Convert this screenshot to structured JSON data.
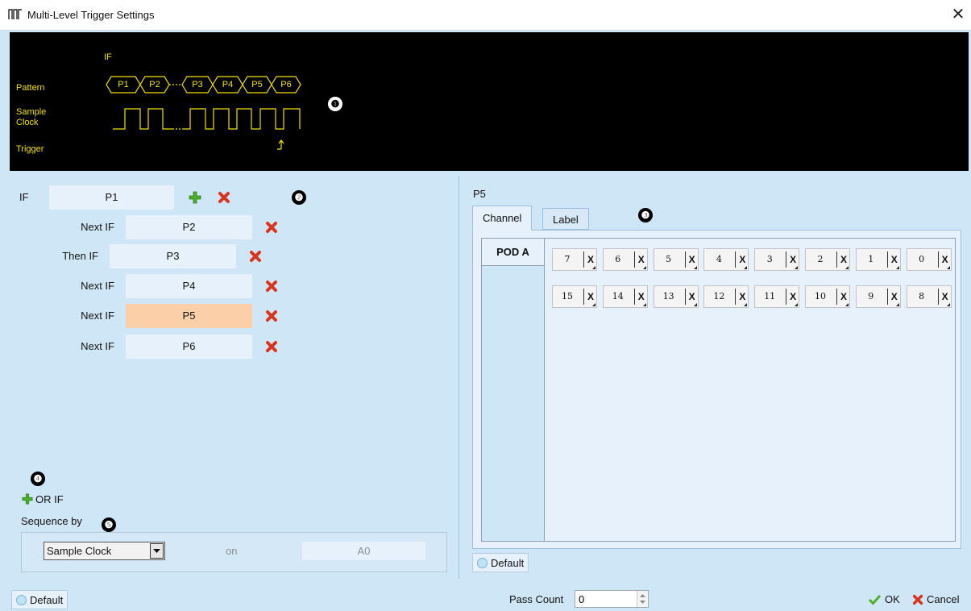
{
  "window": {
    "title": "Multi-Level Trigger Settings",
    "close_label": "✕"
  },
  "diagram": {
    "if_label": "IF",
    "row_labels": {
      "pattern": "Pattern",
      "sample_clock_line1": "Sample",
      "sample_clock_line2": "Clock",
      "trigger": "Trigger"
    },
    "patterns": [
      "P1",
      "P2",
      "P3",
      "P4",
      "P5",
      "P6"
    ],
    "marker": "❶"
  },
  "levels": {
    "marker": "❷",
    "rows": [
      {
        "label": "IF",
        "value": "P1",
        "selected": false
      },
      {
        "label": "Next IF",
        "value": "P2",
        "selected": false
      },
      {
        "label": "Then IF",
        "value": "P3",
        "selected": false
      },
      {
        "label": "Next IF",
        "value": "P4",
        "selected": false
      },
      {
        "label": "Next IF",
        "value": "P5",
        "selected": true
      },
      {
        "label": "Next IF",
        "value": "P6",
        "selected": false
      }
    ],
    "or_if_marker": "❹",
    "or_if_label": "OR IF"
  },
  "sequence": {
    "label": "Sequence by",
    "marker": "❺",
    "source": "Sample Clock",
    "on_label": "on",
    "channel": "A0"
  },
  "pattern_editor": {
    "current": "P5",
    "marker": "❸",
    "tabs": [
      {
        "label": "Channel",
        "active": true
      },
      {
        "label": "Label",
        "active": false
      }
    ],
    "pod_label": "POD A",
    "bits_row1": [
      {
        "num": "7",
        "val": "X"
      },
      {
        "num": "6",
        "val": "X"
      },
      {
        "num": "5",
        "val": "X"
      },
      {
        "num": "4",
        "val": "X"
      },
      {
        "num": "3",
        "val": "X"
      },
      {
        "num": "2",
        "val": "X"
      },
      {
        "num": "1",
        "val": "X"
      },
      {
        "num": "0",
        "val": "X"
      }
    ],
    "bits_row2": [
      {
        "num": "15",
        "val": "X"
      },
      {
        "num": "14",
        "val": "X"
      },
      {
        "num": "13",
        "val": "X"
      },
      {
        "num": "12",
        "val": "X"
      },
      {
        "num": "11",
        "val": "X"
      },
      {
        "num": "10",
        "val": "X"
      },
      {
        "num": "9",
        "val": "X"
      },
      {
        "num": "8",
        "val": "X"
      }
    ],
    "default_label": "Default"
  },
  "footer": {
    "default_label": "Default",
    "pass_count_label": "Pass Count",
    "pass_count_value": "0",
    "ok_label": "OK",
    "cancel_label": "Cancel"
  },
  "colors": {
    "window_bg": "#cfe6f7",
    "diagram_bg": "#000000",
    "diagram_fg": "#f1e100",
    "selected_field": "#fbd0a8",
    "ok_green": "#4caf2a",
    "cancel_red": "#d9341e"
  }
}
